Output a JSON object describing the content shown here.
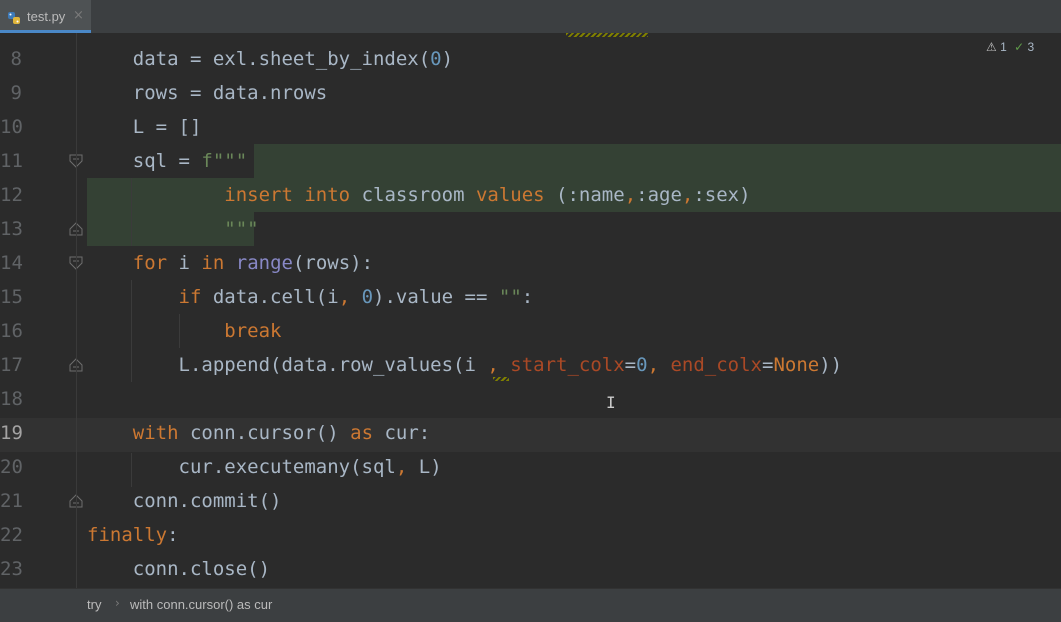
{
  "tab": {
    "filename": "test.py",
    "close_glyph": "×"
  },
  "inspections": {
    "warnings": "1",
    "weak_warnings": "3"
  },
  "lines": [
    {
      "num": "8",
      "tokens": [
        [
          "    data = exl.sheet_by_index(",
          ""
        ],
        [
          "0",
          "num"
        ],
        [
          ")",
          ""
        ]
      ]
    },
    {
      "num": "9",
      "tokens": [
        [
          "    rows = data.nrows",
          ""
        ]
      ]
    },
    {
      "num": "10",
      "tokens": [
        [
          "    L = []",
          ""
        ]
      ]
    },
    {
      "num": "11",
      "tokens": [
        [
          "    sql = ",
          ""
        ],
        [
          "f\"\"\"",
          "str"
        ]
      ]
    },
    {
      "num": "12",
      "tokens": [
        [
          "            ",
          ""
        ],
        [
          "insert into",
          "kw"
        ],
        [
          " classroom ",
          ""
        ],
        [
          "values",
          "kw"
        ],
        [
          " (:name",
          ""
        ],
        [
          ",",
          "kw"
        ],
        [
          ":age",
          ""
        ],
        [
          ",",
          "kw"
        ],
        [
          ":sex)",
          ""
        ]
      ]
    },
    {
      "num": "13",
      "tokens": [
        [
          "            ",
          ""
        ],
        [
          "\"\"\"",
          "str"
        ]
      ]
    },
    {
      "num": "14",
      "tokens": [
        [
          "    ",
          ""
        ],
        [
          "for",
          "kw"
        ],
        [
          " i ",
          ""
        ],
        [
          "in",
          "kw"
        ],
        [
          " ",
          ""
        ],
        [
          "range",
          "builtin"
        ],
        [
          "(rows):",
          ""
        ]
      ]
    },
    {
      "num": "15",
      "tokens": [
        [
          "        ",
          ""
        ],
        [
          "if",
          "kw"
        ],
        [
          " data.cell(i",
          ""
        ],
        [
          ",",
          "kw"
        ],
        [
          " ",
          ""
        ],
        [
          "0",
          "num"
        ],
        [
          ").value == ",
          ""
        ],
        [
          "\"\"",
          "str"
        ],
        [
          ":",
          ""
        ]
      ]
    },
    {
      "num": "16",
      "tokens": [
        [
          "            ",
          ""
        ],
        [
          "break",
          "kw"
        ]
      ]
    },
    {
      "num": "17",
      "tokens": [
        [
          "        L.append(data.row_values(i ",
          ""
        ],
        [
          ",",
          "kw"
        ],
        [
          " ",
          ""
        ],
        [
          "start_colx",
          "param"
        ],
        [
          "=",
          ""
        ],
        [
          "0",
          "num"
        ],
        [
          ",",
          "kw"
        ],
        [
          " ",
          ""
        ],
        [
          "end_colx",
          "param"
        ],
        [
          "=",
          ""
        ],
        [
          "None",
          "kw"
        ],
        [
          "))",
          ""
        ]
      ]
    },
    {
      "num": "18",
      "tokens": []
    },
    {
      "num": "19",
      "tokens": [
        [
          "    ",
          ""
        ],
        [
          "with",
          "kw"
        ],
        [
          " conn.cursor() ",
          ""
        ],
        [
          "as",
          "kw"
        ],
        [
          " cur:",
          ""
        ]
      ]
    },
    {
      "num": "20",
      "tokens": [
        [
          "        cur.executemany(sql",
          ""
        ],
        [
          ",",
          "kw"
        ],
        [
          " L)",
          ""
        ]
      ]
    },
    {
      "num": "21",
      "tokens": [
        [
          "    conn.commit()",
          ""
        ]
      ]
    },
    {
      "num": "22",
      "tokens": [
        [
          "finally",
          "kw"
        ],
        [
          ":",
          ""
        ]
      ]
    },
    {
      "num": "23",
      "tokens": [
        [
          "    conn.close()",
          ""
        ]
      ]
    }
  ],
  "current_line": "19",
  "breadcrumb": {
    "items": [
      "try",
      "with conn.cursor() as cur"
    ],
    "separator": "›"
  },
  "colors": {
    "background": "#2b2b2b",
    "keyword": "#cc7832",
    "number": "#6897bb",
    "string": "#6a8759",
    "builtin": "#8888c6",
    "param": "#aa4926",
    "text": "#a9b7c6",
    "injected_highlight": "#344134"
  },
  "icons": [
    "python-file-icon",
    "close-icon",
    "warning-icon",
    "check-icon",
    "fold-icon",
    "text-cursor-icon",
    "chevron-right-icon"
  ]
}
